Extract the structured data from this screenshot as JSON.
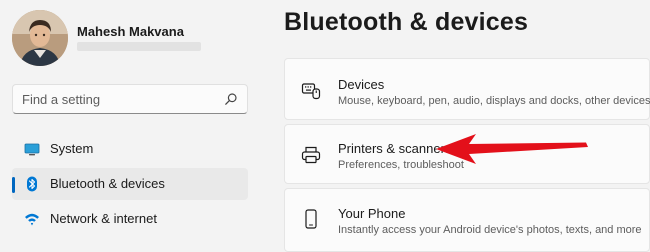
{
  "user": {
    "name": "Mahesh Makvana"
  },
  "search": {
    "placeholder": "Find a setting"
  },
  "sidebar": {
    "items": [
      {
        "label": "System",
        "icon": "monitor-icon"
      },
      {
        "label": "Bluetooth & devices",
        "icon": "bluetooth-icon",
        "active": true
      },
      {
        "label": "Network & internet",
        "icon": "wifi-icon"
      }
    ]
  },
  "page": {
    "title": "Bluetooth & devices"
  },
  "cards": [
    {
      "title": "Devices",
      "subtitle": "Mouse, keyboard, pen, audio, displays and docks, other devices",
      "icon": "devices-icon"
    },
    {
      "title": "Printers & scanners",
      "subtitle": "Preferences, troubleshoot",
      "icon": "printer-icon"
    },
    {
      "title": "Your Phone",
      "subtitle": "Instantly access your Android device's photos, texts, and more",
      "icon": "phone-icon"
    }
  ],
  "colors": {
    "accent": "#0067c0",
    "annotation_arrow": "#e3101a",
    "wifi": "#0078d4"
  }
}
